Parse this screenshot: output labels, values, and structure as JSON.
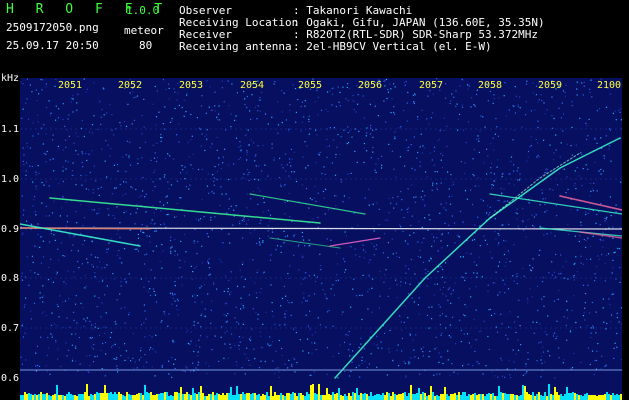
{
  "app": {
    "name": "H R O F F T",
    "version": "1.0.0"
  },
  "file": {
    "name": "2509172050.png",
    "datetime": "25.09.17 20:50",
    "mode_label": "meteor",
    "count": "80"
  },
  "info": {
    "observer_label": "Observer",
    "observer_value": ": Takanori Kawachi",
    "location_label": "Receiving Location",
    "location_value": ": Ogaki, Gifu, JAPAN (136.60E, 35.35N)",
    "receiver_label": "Receiver",
    "receiver_value": ": R820T2(RTL-SDR) SDR-Sharp 53.372MHz",
    "antenna_label": "Receiving antenna",
    "antenna_value": ": 2el-HB9CV Vertical (el. E-W)"
  },
  "axes": {
    "y_unit": "kHz",
    "y_ticks": [
      "1.1",
      "1.0",
      "0.9",
      "0.8",
      "0.7",
      "0.6"
    ],
    "x_ticks": [
      "2051",
      "2052",
      "2053",
      "2054",
      "2055",
      "2056",
      "2057",
      "2058",
      "2059",
      "2100"
    ]
  },
  "colors": {
    "background": "#071060",
    "header_green": "#3cff3c",
    "tick_yellow": "#ffff3c",
    "carrier_white": "#ffffff",
    "baseline_cyan": "#00e0ff",
    "baseline_yellow": "#ffff00"
  }
}
